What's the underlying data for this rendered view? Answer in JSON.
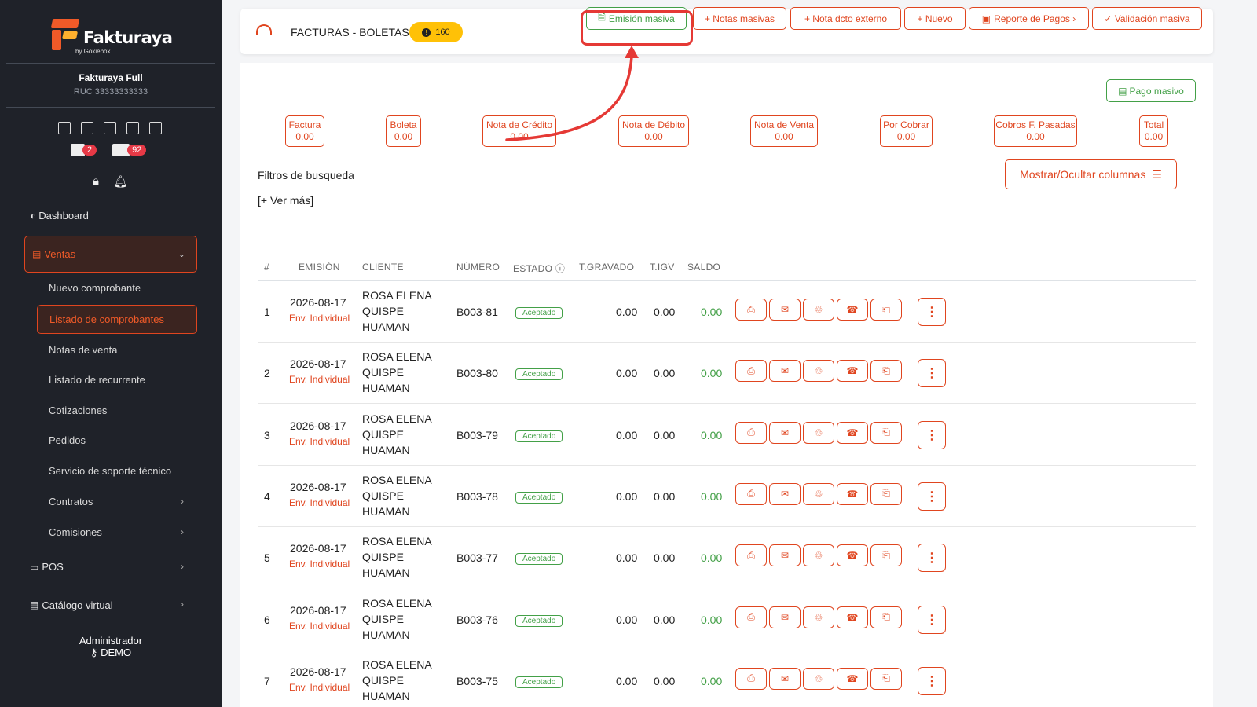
{
  "sidebar": {
    "logo_text": "Fakturaya",
    "logo_sub": "by Gokiebox",
    "company": "Fakturaya Full",
    "ruc": "RUC 33333333333",
    "badge_calendar": "2",
    "badge_boxes": "92",
    "nav": {
      "dashboard": "Dashboard",
      "ventas": "Ventas",
      "pos": "POS",
      "catalogo": "Catálogo virtual"
    },
    "sub_items": [
      "Nuevo comprobante",
      "Listado de comprobantes",
      "Notas de venta",
      "Listado de recurrente",
      "Cotizaciones",
      "Pedidos",
      "Servicio de soporte técnico",
      "Contratos",
      "Comisiones"
    ],
    "user_role": "Administrador",
    "user_name": "DEMO"
  },
  "header": {
    "title": "FACTURAS - BOLETAS",
    "count": "160",
    "buttons": {
      "emision_masiva": "Emisión masiva",
      "notas_masivas": "+ Notas masivas",
      "nota_dcto_externo": "+ Nota dcto externo",
      "nuevo": "+ Nuevo",
      "reporte_pagos": "Reporte de Pagos  ›",
      "validacion_masiva": "✓ Validación masiva"
    }
  },
  "pago_masivo": "Pago masivo",
  "summary": [
    {
      "label": "Factura",
      "value": "0.00"
    },
    {
      "label": "Boleta",
      "value": "0.00"
    },
    {
      "label": "Nota de Crédito",
      "value": "0.00"
    },
    {
      "label": "Nota de Débito",
      "value": "0.00"
    },
    {
      "label": "Nota de Venta",
      "value": "0.00"
    },
    {
      "label": "Por Cobrar",
      "value": "0.00"
    },
    {
      "label": "Cobros F. Pasadas",
      "value": "0.00"
    },
    {
      "label": "Total",
      "value": "0.00"
    }
  ],
  "filters": {
    "title": "Filtros de busqueda",
    "ver_mas": "[+ Ver más]",
    "toggle_columns": "Mostrar/Ocultar columnas"
  },
  "table": {
    "headers": [
      "#",
      "EMISIÓN",
      "CLIENTE",
      "NÚMERO",
      "ESTADO",
      "T.GRAVADO",
      "T.IGV",
      "SALDO"
    ],
    "rows": [
      {
        "n": "1",
        "date": "2026-08-17",
        "env": "Env. Individual",
        "client": "ROSA ELENA QUISPE HUAMAN",
        "numero": "B003-81",
        "estado": "Aceptado",
        "gravado": "0.00",
        "igv": "0.00",
        "saldo": "0.00"
      },
      {
        "n": "2",
        "date": "2026-08-17",
        "env": "Env. Individual",
        "client": "ROSA ELENA QUISPE HUAMAN",
        "numero": "B003-80",
        "estado": "Aceptado",
        "gravado": "0.00",
        "igv": "0.00",
        "saldo": "0.00"
      },
      {
        "n": "3",
        "date": "2026-08-17",
        "env": "Env. Individual",
        "client": "ROSA ELENA QUISPE HUAMAN",
        "numero": "B003-79",
        "estado": "Aceptado",
        "gravado": "0.00",
        "igv": "0.00",
        "saldo": "0.00"
      },
      {
        "n": "4",
        "date": "2026-08-17",
        "env": "Env. Individual",
        "client": "ROSA ELENA QUISPE HUAMAN",
        "numero": "B003-78",
        "estado": "Aceptado",
        "gravado": "0.00",
        "igv": "0.00",
        "saldo": "0.00"
      },
      {
        "n": "5",
        "date": "2026-08-17",
        "env": "Env. Individual",
        "client": "ROSA ELENA QUISPE HUAMAN",
        "numero": "B003-77",
        "estado": "Aceptado",
        "gravado": "0.00",
        "igv": "0.00",
        "saldo": "0.00"
      },
      {
        "n": "6",
        "date": "2026-08-17",
        "env": "Env. Individual",
        "client": "ROSA ELENA QUISPE HUAMAN",
        "numero": "B003-76",
        "estado": "Aceptado",
        "gravado": "0.00",
        "igv": "0.00",
        "saldo": "0.00"
      },
      {
        "n": "7",
        "date": "2026-08-17",
        "env": "Env. Individual",
        "client": "ROSA ELENA QUISPE HUAMAN",
        "numero": "B003-75",
        "estado": "Aceptado",
        "gravado": "0.00",
        "igv": "0.00",
        "saldo": "0.00"
      }
    ],
    "action_icons": [
      "printer-icon",
      "mail-icon",
      "trash-icon",
      "whatsapp-icon",
      "xml-file-icon"
    ]
  },
  "colors": {
    "accent": "#e0451f",
    "success": "#43a047",
    "sidebar_bg": "#1f2229",
    "count_badge": "#ffc107",
    "annotation": "#e53935"
  }
}
